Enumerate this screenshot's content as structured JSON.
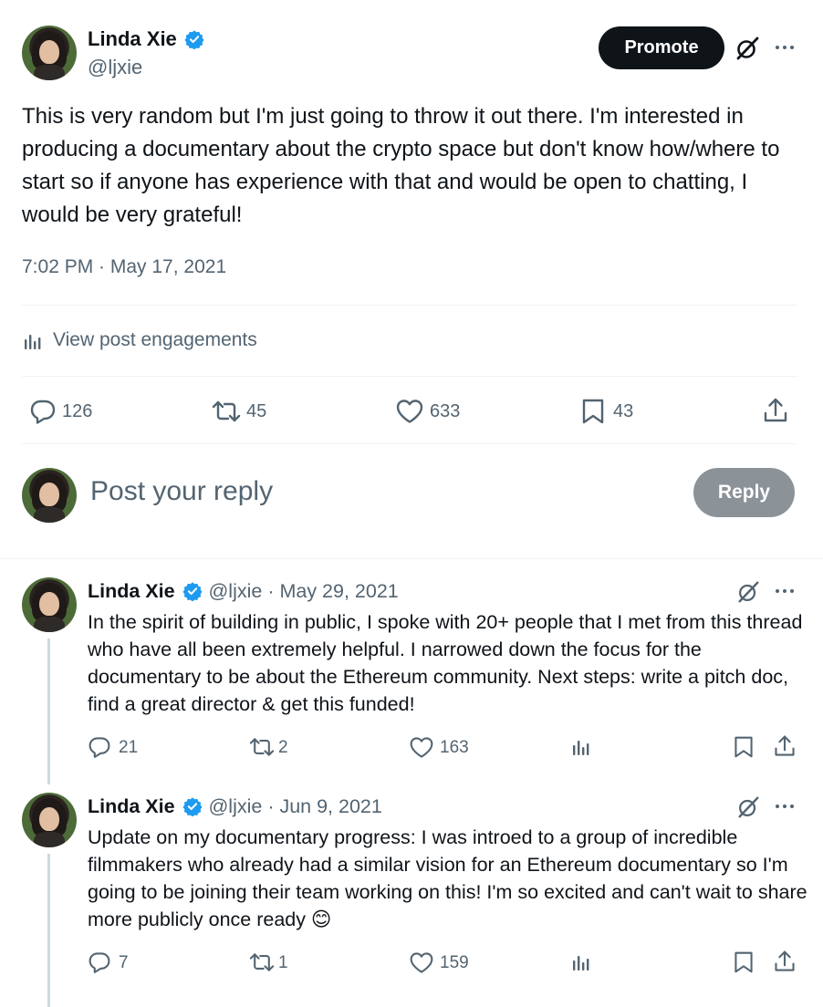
{
  "post": {
    "author_name": "Linda Xie",
    "author_handle": "@ljxie",
    "promote_label": "Promote",
    "text": "This is very random but I'm just going to throw it out there. I'm interested in producing a documentary about the crypto space but don't know how/where to start so if anyone has experience with that and would be open to chatting, I would be very grateful!",
    "timestamp": "7:02 PM · May 17, 2021",
    "engagements_label": "View post engagements",
    "stats": {
      "replies": "126",
      "reposts": "45",
      "likes": "633",
      "bookmarks": "43"
    }
  },
  "composer": {
    "placeholder": "Post your reply",
    "reply_label": "Reply"
  },
  "replies": [
    {
      "author_name": "Linda Xie",
      "meta": "@ljxie · May 29, 2021",
      "text": "In the spirit of building in public, I spoke with 20+ people that I met from this thread who have all been extremely helpful. I narrowed down the focus for the documentary to be about the Ethereum community. Next steps: write a pitch doc, find a great director & get this funded!",
      "replies": "21",
      "reposts": "2",
      "likes": "163"
    },
    {
      "author_name": "Linda Xie",
      "meta": "@ljxie · Jun 9, 2021",
      "text": "Update on my documentary progress: I was introed to a group of incredible filmmakers who already had a similar vision for an Ethereum documentary so I'm going to be joining their team working on this! I'm so excited and can't wait to share more publicly once ready 😊",
      "replies": "7",
      "reposts": "1",
      "likes": "159"
    }
  ],
  "colors": {
    "accent": "#1d9bf0",
    "text": "#0f1419",
    "muted": "#536471",
    "reply_button": "#8b9298"
  }
}
